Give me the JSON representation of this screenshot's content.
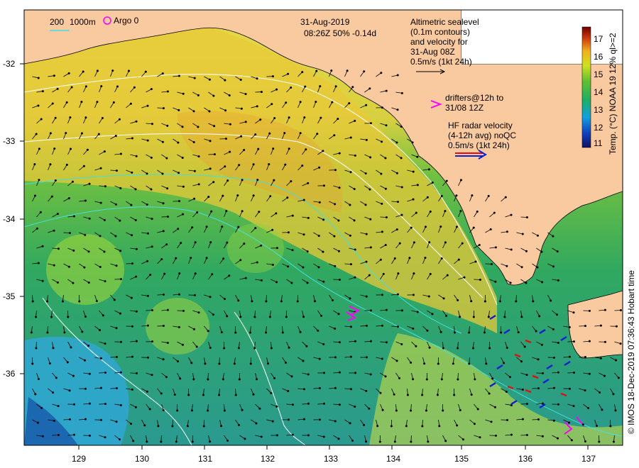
{
  "header": {
    "date": "31-Aug-2019",
    "time_line": "08:26Z  50% -0.14d"
  },
  "legend": {
    "contour_200": "200",
    "contour_1000": "1000m",
    "argo": "Argo 0",
    "altimetry_lines": [
      "Altimetric sealevel",
      "(0.1m contours)",
      "and velocity for",
      "31-Aug 08Z",
      "0.5m/s (1kt 24h)"
    ],
    "drifters_lines": [
      "drifters@12h to",
      "31/08 12Z"
    ],
    "hf_lines": [
      "HF radar velocity",
      "(4-12h avg) noQC",
      "0.5m/s (1kt 24h)"
    ]
  },
  "axes": {
    "x_ticks": [
      "129",
      "130",
      "131",
      "132",
      "133",
      "134",
      "135",
      "136",
      "137"
    ],
    "y_ticks": [
      "-32",
      "-33",
      "-34",
      "-35",
      "-36"
    ]
  },
  "colorbar": {
    "title": "Temp. (°C) NOAA 19 12% ql>=2",
    "ticks": [
      "17",
      "16",
      "15",
      "14",
      "13",
      "12",
      "11"
    ],
    "min": 11,
    "max": 17.5
  },
  "credit": "© IMOS 18-Dec-2019 07:36:43 Hobart time",
  "colors": {
    "land": "#f9c9a0",
    "warm_sea": "#e6d24a",
    "mid_sea": "#3fb53f",
    "cool_sea": "#2a9a8a",
    "hf_red": "#e01010",
    "hf_blue": "#1020d0",
    "drifter": "#ff00ff",
    "contour_white": "#ffffff",
    "contour_cyan": "#40e0e0"
  }
}
